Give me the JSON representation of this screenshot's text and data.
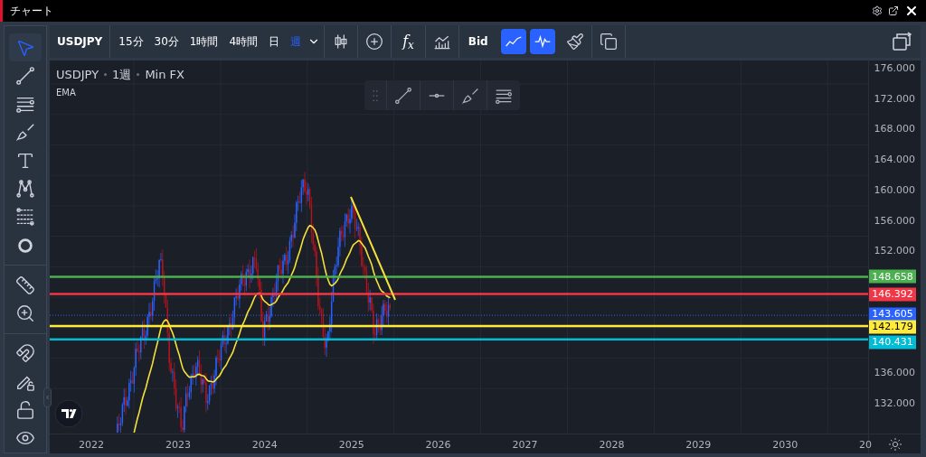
{
  "window": {
    "title": "チャート"
  },
  "toolbar": {
    "symbol": "USDJPY",
    "intervals": [
      {
        "label": "15分",
        "selected": false
      },
      {
        "label": "30分",
        "selected": false
      },
      {
        "label": "1時間",
        "selected": false
      },
      {
        "label": "4時間",
        "selected": false
      },
      {
        "label": "日",
        "selected": false
      },
      {
        "label": "週",
        "selected": true
      }
    ],
    "function_label": "f$_{x}$",
    "price_source": "Bid",
    "toggles": [
      {
        "kind": "trend",
        "on": true
      },
      {
        "kind": "pulse",
        "on": true
      }
    ]
  },
  "left_tools": [
    {
      "kind": "cursor",
      "selected": true
    },
    {
      "kind": "line",
      "selected": false
    },
    {
      "kind": "lines",
      "selected": false
    },
    {
      "kind": "brush",
      "selected": false
    },
    {
      "kind": "text",
      "selected": false
    },
    {
      "kind": "pattern",
      "selected": false
    },
    {
      "kind": "fib",
      "selected": false
    },
    {
      "kind": "circle",
      "selected": false
    },
    {
      "kind": "divider"
    },
    {
      "kind": "ruler",
      "selected": false
    },
    {
      "kind": "zoom",
      "selected": false
    },
    {
      "kind": "divider"
    },
    {
      "kind": "magnet",
      "selected": false
    },
    {
      "kind": "pencil-lock",
      "selected": false
    },
    {
      "kind": "lock",
      "selected": false
    },
    {
      "kind": "eye",
      "selected": false
    }
  ],
  "chart": {
    "legend": {
      "symbol": "USDJPY",
      "interval": "1週",
      "source": "Min FX"
    },
    "indicator": "EMA",
    "price_ticks": [
      "176.000",
      "172.000",
      "168.000",
      "164.000",
      "160.000",
      "156.000",
      "152.000",
      "136.000",
      "132.000"
    ],
    "year_labels": [
      "2022",
      "2023",
      "2024",
      "2025",
      "2026",
      "2027",
      "2028",
      "2029",
      "2030",
      "20"
    ],
    "levels": [
      {
        "kind": "level",
        "label": "148.658",
        "color": "#4caf50"
      },
      {
        "kind": "level",
        "label": "146.392",
        "color": "#f23645"
      },
      {
        "kind": "last",
        "label": "143.605",
        "color": "#2962ff"
      },
      {
        "kind": "level",
        "label": "142.179",
        "color": "#ffeb3b"
      },
      {
        "kind": "level",
        "label": "140.431",
        "color": "#00bcd4"
      }
    ]
  }
}
